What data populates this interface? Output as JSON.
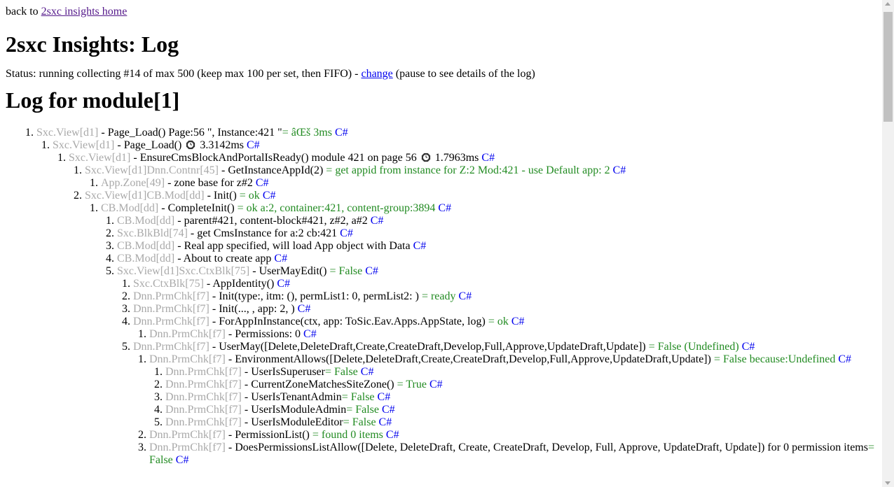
{
  "back": {
    "prefix": "back to ",
    "link": "2sxc insights home"
  },
  "title": "2sxc Insights: Log",
  "status": {
    "text": "Status: running collecting #14 of max 500 (keep max 100 per set, then FIFO) - ",
    "link": "change",
    "suffix": " (pause to see details of the log)"
  },
  "log_title": "Log for module[1]",
  "cs_label": "C#",
  "clock_icon": "clock-icon",
  "colors": {
    "source": "#a9a9a9",
    "result": "#228b22",
    "link": "#0000ee",
    "visited": "#551a8b"
  },
  "entries": [
    {
      "src": "Sxc.View[d1]",
      "msg": " - Page_Load() Page:56 \", Instance:421 \"",
      "res": "= âŒš 3ms",
      "children": [
        {
          "src": "Sxc.View[d1]",
          "msg": " - Page_Load() ",
          "clock": true,
          "post": " 3.3142ms",
          "children": [
            {
              "src": "Sxc.View[d1]",
              "msg": " - EnsureCmsBlockAndPortalIsReady() module 421 on page 56 ",
              "clock": true,
              "post": " 1.7963ms",
              "children": [
                {
                  "src": "Sxc.View[d1]Dnn.Contnr[45]",
                  "msg": " - GetInstanceAppId(2) ",
                  "res": "= get appid from instance for Z:2 Mod:421 - use Default app: 2",
                  "children": [
                    {
                      "src": "App.Zone[49]",
                      "msg": " - zone base for z#2"
                    }
                  ]
                },
                {
                  "src": "Sxc.View[d1]CB.Mod[dd]",
                  "msg": " - Init() ",
                  "res": "= ok",
                  "children": [
                    {
                      "src": "CB.Mod[dd]",
                      "msg": " - CompleteInit() ",
                      "res": "= ok a:2, container:421, content-group:3894",
                      "children": [
                        {
                          "src": "CB.Mod[dd]",
                          "msg": " - parent#421, content-block#421, z#2, a#2"
                        },
                        {
                          "src": "Sxc.BlkBld[74]",
                          "msg": " - get CmsInstance for a:2 cb:421"
                        },
                        {
                          "src": "CB.Mod[dd]",
                          "msg": " - Real app specified, will load App object with Data"
                        },
                        {
                          "src": "CB.Mod[dd]",
                          "msg": " - About to create app"
                        },
                        {
                          "src": "Sxc.View[d1]Sxc.CtxBlk[75]",
                          "msg": " - UserMayEdit() ",
                          "res": "= False",
                          "children": [
                            {
                              "src": "Sxc.CtxBlk[75]",
                              "msg": " - AppIdentity()"
                            },
                            {
                              "src": "Dnn.PrmChk[f7]",
                              "msg": " - Init(type:, itm: (), permList1: 0, permList2: ) ",
                              "res": "= ready"
                            },
                            {
                              "src": "Dnn.PrmChk[f7]",
                              "msg": " - Init(..., , app: 2, )"
                            },
                            {
                              "src": "Dnn.PrmChk[f7]",
                              "msg": " - ForAppInInstance(ctx, app: ToSic.Eav.Apps.AppState, log) ",
                              "res": "= ok",
                              "children": [
                                {
                                  "src": "Dnn.PrmChk[f7]",
                                  "msg": " - Permissions: 0"
                                }
                              ]
                            },
                            {
                              "src": "Dnn.PrmChk[f7]",
                              "msg": " - UserMay([Delete,DeleteDraft,Create,CreateDraft,Develop,Full,Approve,UpdateDraft,Update]) ",
                              "res": "= False (Undefined)",
                              "children": [
                                {
                                  "src": "Dnn.PrmChk[f7]",
                                  "msg": " - EnvironmentAllows([Delete,DeleteDraft,Create,CreateDraft,Develop,Full,Approve,UpdateDraft,Update]) ",
                                  "res": "= False because:Undefined",
                                  "children": [
                                    {
                                      "src": "Dnn.PrmChk[f7]",
                                      "msg": " - UserIsSuperuser",
                                      "res": "= False"
                                    },
                                    {
                                      "src": "Dnn.PrmChk[f7]",
                                      "msg": " - CurrentZoneMatchesSiteZone() ",
                                      "res": "= True"
                                    },
                                    {
                                      "src": "Dnn.PrmChk[f7]",
                                      "msg": " - UserIsTenantAdmin",
                                      "res": "= False"
                                    },
                                    {
                                      "src": "Dnn.PrmChk[f7]",
                                      "msg": " - UserIsModuleAdmin",
                                      "res": "= False"
                                    },
                                    {
                                      "src": "Dnn.PrmChk[f7]",
                                      "msg": " - UserIsModuleEditor",
                                      "res": "= False"
                                    }
                                  ]
                                },
                                {
                                  "src": "Dnn.PrmChk[f7]",
                                  "msg": " - PermissionList() ",
                                  "res": "= found 0 items"
                                },
                                {
                                  "src": "Dnn.PrmChk[f7]",
                                  "msg": " - DoesPermissionsListAllow([Delete, DeleteDraft, Create, CreateDraft, Develop, Full, Approve, UpdateDraft, Update]) for 0 permission items",
                                  "res": "= False"
                                }
                              ]
                            }
                          ]
                        }
                      ]
                    }
                  ]
                }
              ]
            }
          ]
        }
      ]
    }
  ]
}
